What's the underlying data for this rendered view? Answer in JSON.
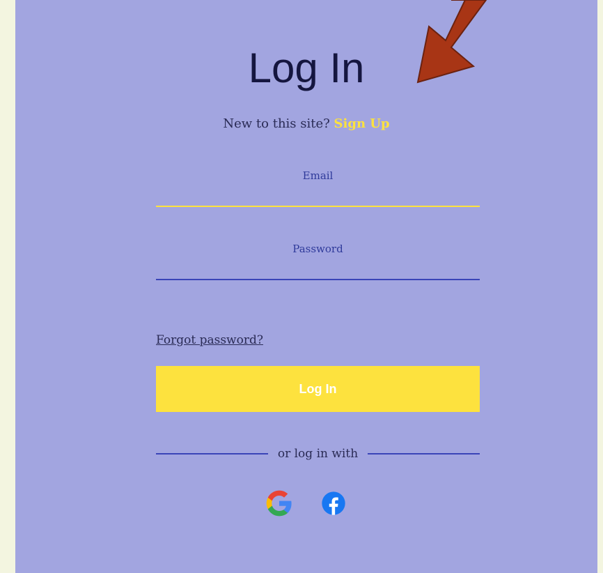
{
  "login": {
    "title": "Log In",
    "signup_prompt": "New to this site?",
    "signup_link": "Sign Up",
    "email_label": "Email",
    "email_value": "",
    "password_label": "Password",
    "password_value": "",
    "forgot_link": "Forgot password?",
    "submit_label": "Log In",
    "divider_text": "or log in with",
    "social": [
      {
        "provider": "google",
        "icon": "google-icon"
      },
      {
        "provider": "facebook",
        "icon": "facebook-icon"
      }
    ]
  },
  "colors": {
    "page_background": "#f3f5e0",
    "panel_background": "#a2a5e0",
    "accent_yellow": "#fde23e",
    "line_blue": "#3a44b8",
    "title_text": "#15163f",
    "arrow_fill": "#a83515",
    "arrow_stroke": "#6b2210"
  }
}
